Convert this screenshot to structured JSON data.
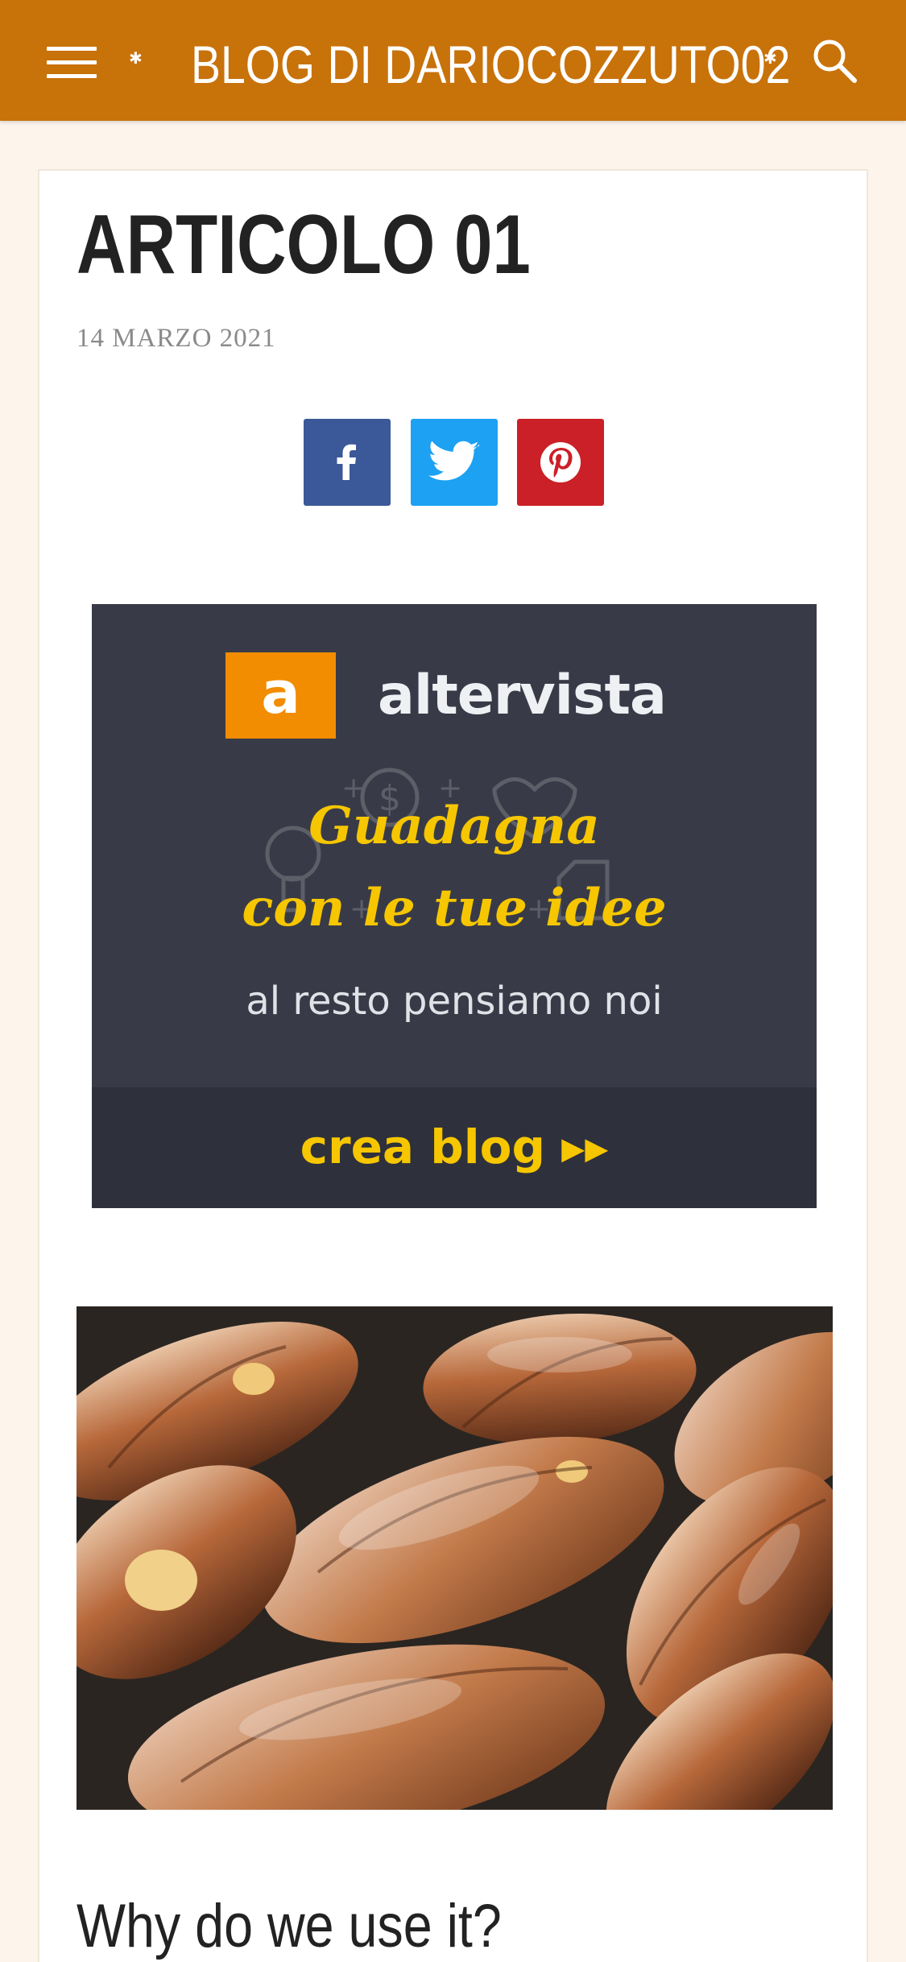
{
  "header": {
    "title": "BLOG DI DARIOCOZZUTO02",
    "menu_icon": "hamburger-menu-icon",
    "search_icon": "search-icon",
    "background_color": "#c8720a"
  },
  "post": {
    "title": "ARTICOLO 01",
    "date": "14 MARZO 2021",
    "share": [
      {
        "network": "facebook",
        "icon": "facebook-icon",
        "color": "#3b5998"
      },
      {
        "network": "twitter",
        "icon": "twitter-icon",
        "color": "#1da1f2"
      },
      {
        "network": "pinterest",
        "icon": "pinterest-icon",
        "color": "#cb2027"
      }
    ],
    "ad": {
      "logo_letter": "a",
      "brand": "altervista",
      "line1": "Guadagna",
      "line2": "con le tue idee",
      "line3": "al resto pensiamo noi",
      "cta": "crea blog ▸▸"
    },
    "image": "croissants-photo",
    "section_heading": "Why do we use it?"
  }
}
